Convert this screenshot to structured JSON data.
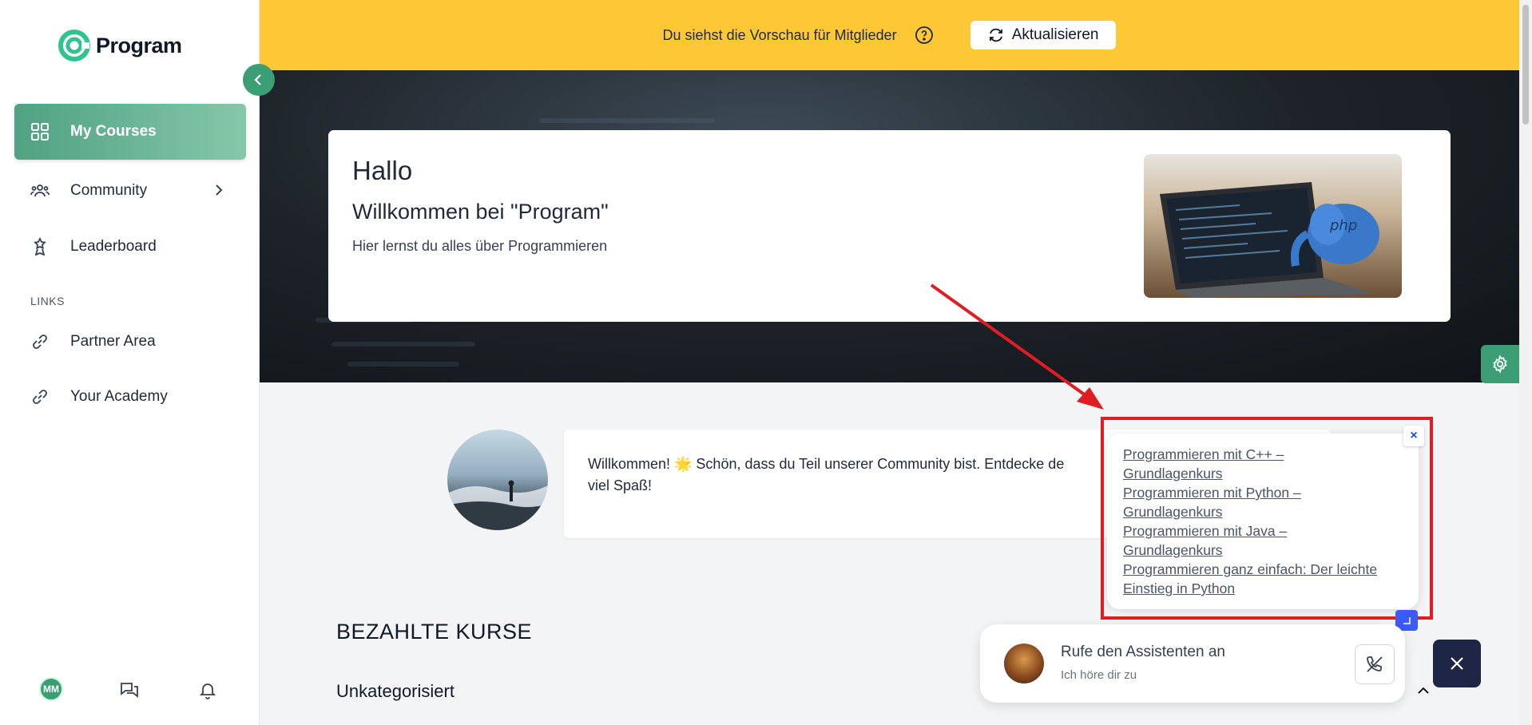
{
  "brand": {
    "name": "Program",
    "color": "#3b9e74"
  },
  "sidebar": {
    "items": [
      {
        "label": "My Courses",
        "icon": "grid-icon",
        "active": true
      },
      {
        "label": "Community",
        "icon": "people-icon"
      },
      {
        "label": "Leaderboard",
        "icon": "trophy-icon"
      }
    ],
    "links_label": "LINKS",
    "links": [
      {
        "label": "Partner Area",
        "icon": "link-icon"
      },
      {
        "label": "Your Academy",
        "icon": "link-icon"
      }
    ],
    "user_initials": "MM"
  },
  "banner": {
    "text": "Du siehst die Vorschau für Mitglieder",
    "refresh_label": "Aktualisieren",
    "color": "#fdc735"
  },
  "hero": {
    "title": "Hallo",
    "subtitle": "Willkommen bei \"Program\"",
    "description": "Hier lernst du alles über Programmieren"
  },
  "welcome": {
    "line1": "Willkommen! 🌟 Schön, dass du Teil unserer Community bist. Entdecke de",
    "line2": "viel Spaß!"
  },
  "sections": {
    "paid_courses": "BEZAHLTE KURSE",
    "uncategorized": "Unkategorisiert"
  },
  "popup": {
    "close_label": "×",
    "links": [
      "Programmieren mit C++ – Grundlagenkurs",
      "Programmieren mit Python – Grundlagenkurs",
      "Programmieren mit Java – Grundlagenkurs",
      "Programmieren ganz einfach: Der leichte Einstieg in Python"
    ]
  },
  "assistant": {
    "title": "Rufe den Assistenten an",
    "subtitle": "Ich höre dir zu"
  },
  "annotation": {
    "color": "#e11d24"
  }
}
